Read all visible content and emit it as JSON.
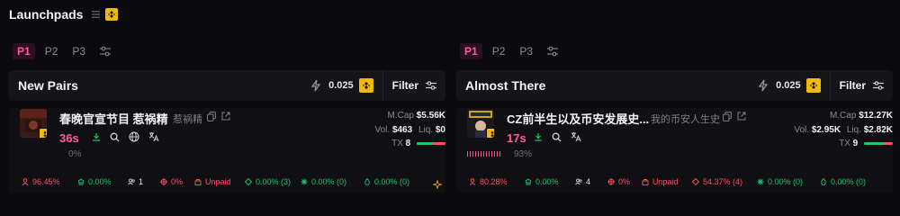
{
  "app": {
    "title": "Launchpads"
  },
  "pages": [
    "P1",
    "P2",
    "P3"
  ],
  "colors": {
    "accent_pink": "#ff5c9a",
    "bnb": "#f0b90b",
    "red": "#ff4f5e",
    "green": "#21c46b"
  },
  "panels": [
    {
      "title": "New Pairs",
      "amount": "0.025",
      "filter_label": "Filter",
      "token": {
        "name": "春晚官宣节目 惹祸精",
        "symbol": "惹祸精",
        "age": "36s",
        "progress_text": "0%",
        "progress": 0,
        "mcap_label": "M.Cap",
        "mcap": "$5.56K",
        "vol_label": "Vol.",
        "vol": "$463",
        "liq_label": "Liq.",
        "liq": "$0",
        "tx_label": "TX",
        "tx": "8",
        "tx_buy_ratio": 0.55,
        "metrics": {
          "top10": "96.45%",
          "dev": "0.00%",
          "holders": "1",
          "snipers": "0%",
          "dex_paid": "Unpaid",
          "insiders": "0.00% (3)",
          "bundlers": "0.00% (0)",
          "lp_burned": "0.00% (0)"
        }
      }
    },
    {
      "title": "Almost There",
      "amount": "0.025",
      "filter_label": "Filter",
      "token": {
        "name": "CZ前半生以及币安发展史...",
        "symbol": "我的币安人生史",
        "age": "17s",
        "progress_text": "93%",
        "progress": 0.93,
        "mcap_label": "M.Cap",
        "mcap": "$12.27K",
        "vol_label": "Vol.",
        "vol": "$2.95K",
        "liq_label": "Liq.",
        "liq": "$2.82K",
        "tx_label": "TX",
        "tx": "9",
        "tx_buy_ratio": 0.65,
        "metrics": {
          "top10": "80.28%",
          "dev": "0.00%",
          "holders": "4",
          "snipers": "0%",
          "dex_paid": "Unpaid",
          "insiders": "54.37% (4)",
          "bundlers": "0.00% (0)",
          "lp_burned": "0.00% (0)"
        }
      }
    }
  ]
}
